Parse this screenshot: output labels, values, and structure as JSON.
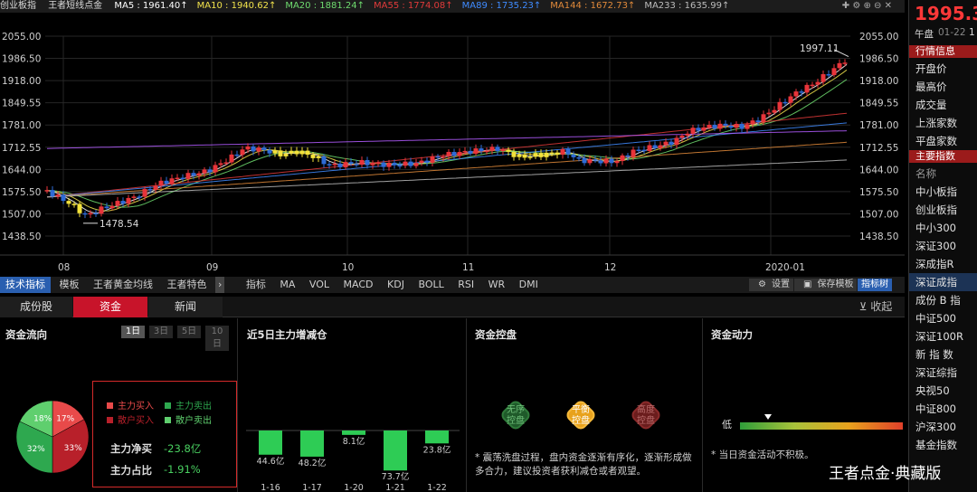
{
  "header": {
    "indicator": "创业板指",
    "strategy": "王者短线点金",
    "ma": [
      {
        "label": "MA5 : 1961.40↑",
        "color": "#ffffff"
      },
      {
        "label": "MA10 : 1940.62↑",
        "color": "#f2e34c"
      },
      {
        "label": "MA20 : 1881.24↑",
        "color": "#6fdc6f"
      },
      {
        "label": "MA55 : 1774.08↑",
        "color": "#e03a3a"
      },
      {
        "label": "MA89 : 1735.23↑",
        "color": "#3f8bff"
      },
      {
        "label": "MA144 : 1672.73↑",
        "color": "#e0893a"
      },
      {
        "label": "MA233 : 1635.99↑",
        "color": "#bcbcbc"
      }
    ]
  },
  "right": {
    "price": "1995.3",
    "session": "午盘",
    "date": "01-22",
    "num": "1",
    "section1": "行情信息",
    "items1": [
      "开盘价",
      "最高价",
      "成交量",
      "上涨家数",
      "平盘家数"
    ],
    "section2": "主要指数",
    "name_header": "名称",
    "items2": [
      "中小板指",
      "创业板指",
      "中小300",
      "深证300",
      "深成指R",
      "深证成指",
      "成份 B 指",
      "中证500",
      "深证100R",
      "新 指 数",
      "深证综指",
      "央视50",
      "中证800",
      "沪深300",
      "基金指数"
    ]
  },
  "chart_data": {
    "type": "candlestick",
    "y_ticks": [
      "2055.00",
      "1986.50",
      "1918.00",
      "1849.55",
      "1781.00",
      "1712.55",
      "1644.00",
      "1575.50",
      "1507.00",
      "1438.50"
    ],
    "ylim": [
      1438.5,
      2055
    ],
    "x_ticks": [
      "08",
      "09",
      "10",
      "11",
      "12",
      "2020-01"
    ],
    "annotations": [
      {
        "label": "1997.11"
      },
      {
        "label": "1478.54"
      }
    ]
  },
  "toolbar": {
    "tabs": [
      "技术指标",
      "模板",
      "王者黄金均线",
      "王者特色",
      "指标",
      "MA",
      "VOL",
      "MACD",
      "KDJ",
      "BOLL",
      "RSI",
      "WR",
      "DMI"
    ],
    "settings": "设置",
    "save_template": "保存模板",
    "indicator_tree": "指标树"
  },
  "subtabs": [
    "成份股",
    "资金",
    "新闻"
  ],
  "collapse": "收起",
  "flow": {
    "title": "资金流向",
    "periods": [
      "1日",
      "3日",
      "5日",
      "10日"
    ],
    "pie": [
      {
        "label": "17%",
        "value": 17,
        "color": "#e84a4a"
      },
      {
        "label": "33%",
        "value": 33,
        "color": "#b8202a"
      },
      {
        "label": "32%",
        "value": 32,
        "color": "#2ea84f"
      },
      {
        "label": "18%",
        "value": 18,
        "color": "#5fcf6e"
      }
    ],
    "legend": [
      {
        "label": "主力买入",
        "color": "#e84a4a"
      },
      {
        "label": "主力卖出",
        "color": "#2ea84f"
      },
      {
        "label": "散户买入",
        "color": "#b8202a"
      },
      {
        "label": "散户卖出",
        "color": "#5fcf6e"
      }
    ],
    "net_label": "主力净买",
    "net_value": "-23.8亿",
    "ratio_label": "主力占比",
    "ratio_value": "-1.91%"
  },
  "five_day": {
    "title": "近5日主力增减仓",
    "bars": [
      {
        "date": "1-16",
        "label": "44.6亿",
        "value": -44.6
      },
      {
        "date": "1-17",
        "label": "48.2亿",
        "value": -48.2
      },
      {
        "date": "1-20",
        "label": "8.1亿",
        "value": -8.1
      },
      {
        "date": "1-21",
        "label": "73.7亿",
        "value": -73.7
      },
      {
        "date": "1-22",
        "label": "23.8亿",
        "value": -23.8
      }
    ]
  },
  "control": {
    "title": "资金控盘",
    "states": [
      {
        "label": "无序控盘",
        "color": "#1f5a2a"
      },
      {
        "label": "平衡控盘",
        "color": "#e8a21d"
      },
      {
        "label": "高度控盘",
        "color": "#6b1d1d"
      }
    ],
    "note": "* 震荡洗盘过程，盘内资金逐渐有序化，逐渐形成做多合力，建议投资者获利减仓或者观望。"
  },
  "power": {
    "title": "资金动力",
    "low": "低",
    "level": 0.1,
    "note": "* 当日资金活动不积极。"
  },
  "watermark": "王者点金·典藏版"
}
